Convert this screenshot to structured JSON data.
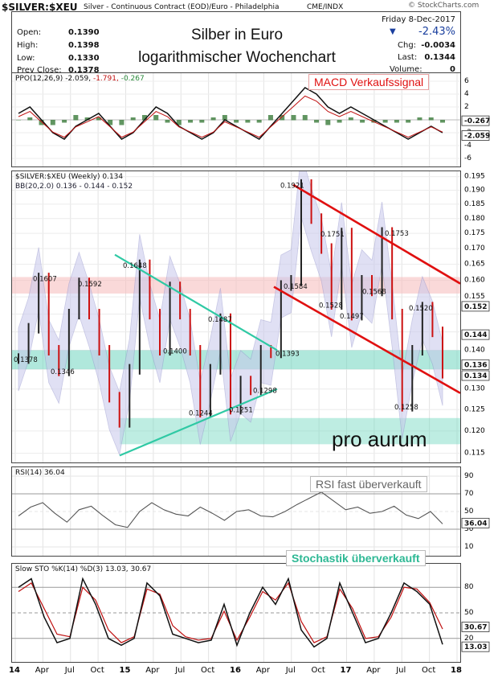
{
  "header": {
    "symbol": "$SILVER:$XEU",
    "description": "Silver - Continuous Contract (EOD)/Euro - Philadelphia",
    "exchange": "CME/INDX",
    "source": "© StockCharts.com",
    "date": "Friday  8-Dec-2017",
    "change_pct": "-2.43%",
    "chg": "-0.0034",
    "last": "0.1344",
    "volume": "0",
    "open": "0.1390",
    "high": "0.1398",
    "low": "0.1330",
    "prev_close": "0.1378",
    "labels": {
      "chg": "Chg:",
      "last": "Last:",
      "volume": "Volume:",
      "open": "Open:",
      "high": "High:",
      "low": "Low:",
      "prev_close": "Prev Close:"
    },
    "title_line1": "Silber in Euro",
    "title_line2": "logarithmischer Wochenchart"
  },
  "ppo": {
    "label": "PPO(12,26,9)",
    "v1": "-2.059,",
    "v2": "-1.791,",
    "v3": "-0.267",
    "ticks": [
      "6",
      "4",
      "2",
      "-2",
      "-4",
      "-6"
    ],
    "badge1": "-0.267",
    "badge2": "-2.059",
    "callout": "MACD Verkaufssignal"
  },
  "price": {
    "label": "$SILVER:$XEU (Weekly) 0.134",
    "bb_label": "BB(20,2.0) 0.136 - 0.144 - 0.152",
    "ticks": [
      "0.195",
      "0.190",
      "0.185",
      "0.180",
      "0.175",
      "0.170",
      "0.165",
      "0.160",
      "0.155",
      "0.150",
      "0.145",
      "0.140",
      "0.135",
      "0.130",
      "0.125",
      "0.120",
      "0.115"
    ],
    "badges": [
      "0.152",
      "0.144",
      "0.136",
      "0.134"
    ],
    "annotations": [
      "0.1378",
      "0.1607",
      "0.1346",
      "0.1592",
      "0.1648",
      "0.1400",
      "0.1244",
      "0.1487",
      "0.1251",
      "0.1298",
      "0.1393",
      "0.1584",
      "0.1921",
      "0.1528",
      "0.1751",
      "0.1497",
      "0.1568",
      "0.1753",
      "0.1520",
      "0.1258"
    ],
    "logo": "pro aurum"
  },
  "rsi": {
    "label": "RSI(14) 36.04",
    "ticks": [
      "90",
      "70",
      "50",
      "30",
      "10"
    ],
    "badge": "36.04",
    "callout": "RSI fast überverkauft"
  },
  "sto": {
    "label": "Slow STO %K(14) %D(3) 13.03, 30.67",
    "ticks": [
      "80",
      "50",
      "20"
    ],
    "badge1": "30.67",
    "badge2": "13.03",
    "callout": "Stochastik überverkauft"
  },
  "x_axis": [
    "14",
    "Apr",
    "Jul",
    "Oct",
    "15",
    "Apr",
    "Jul",
    "Oct",
    "16",
    "Apr",
    "Jul",
    "Oct",
    "17",
    "Apr",
    "Jul",
    "Oct",
    "18"
  ],
  "colors": {
    "up": "#222222",
    "down": "#cc1111",
    "bb_fill": "#c8c8ec",
    "teal": "#2fc9a4",
    "red_line": "#e01010",
    "pink_band": "#f6c0c0",
    "green_band": "#6fd6bf"
  },
  "chart_data": [
    {
      "type": "line",
      "title": "$SILVER:$XEU (Weekly) 0.134",
      "subtitle": "BB(20,2.0) 0.136 - 0.144 - 0.152",
      "scale": "log",
      "ylim": [
        0.113,
        0.197
      ],
      "x": [
        "14",
        "Apr",
        "Jul",
        "Oct",
        "15",
        "Apr",
        "Jul",
        "Oct",
        "16",
        "Apr",
        "Jul",
        "Oct",
        "17",
        "Apr",
        "Jul",
        "Oct",
        "18"
      ],
      "series": [
        {
          "name": "$SILVER:$XEU",
          "values": [
            0.1378,
            0.146,
            0.1607,
            0.14,
            0.1346,
            0.15,
            0.1592,
            0.15,
            0.14,
            0.128,
            0.122,
            0.135,
            0.1648,
            0.15,
            0.14,
            0.158,
            0.15,
            0.14,
            0.1244,
            0.135,
            0.1487,
            0.1251,
            0.132,
            0.1298,
            0.14,
            0.1393,
            0.1584,
            0.16,
            0.1921,
            0.18,
            0.17,
            0.1528,
            0.1751,
            0.1497,
            0.16,
            0.1568,
            0.1753,
            0.15,
            0.1258,
            0.14,
            0.152,
            0.145,
            0.134
          ]
        }
      ],
      "annotations": [
        {
          "label": "0.1921",
          "value": 0.1921
        },
        {
          "label": "0.1258",
          "value": 0.1258
        },
        {
          "label": "0.1244",
          "value": 0.1244
        }
      ]
    },
    {
      "type": "line",
      "title": "RSI(14) 36.04",
      "ylim": [
        0,
        100
      ],
      "series": [
        {
          "name": "RSI(14)",
          "values": [
            45,
            55,
            60,
            48,
            38,
            52,
            56,
            45,
            35,
            32,
            50,
            60,
            52,
            47,
            45,
            55,
            48,
            40,
            50,
            52,
            45,
            44,
            50,
            58,
            65,
            72,
            62,
            52,
            55,
            48,
            50,
            56,
            46,
            42,
            50,
            36
          ]
        }
      ]
    },
    {
      "type": "line",
      "title": "Slow STO %K(14) %D(3) 13.03, 30.67",
      "ylim": [
        0,
        100
      ],
      "series": [
        {
          "name": "%K",
          "values": [
            80,
            90,
            45,
            15,
            20,
            90,
            60,
            20,
            12,
            20,
            85,
            70,
            25,
            20,
            15,
            18,
            60,
            12,
            50,
            80,
            60,
            90,
            30,
            10,
            20,
            85,
            50,
            15,
            20,
            50,
            85,
            75,
            60,
            13
          ]
        },
        {
          "name": "%D",
          "values": [
            75,
            85,
            55,
            25,
            22,
            80,
            65,
            30,
            15,
            22,
            78,
            72,
            35,
            22,
            18,
            20,
            52,
            18,
            45,
            75,
            65,
            85,
            40,
            15,
            22,
            78,
            55,
            20,
            22,
            45,
            80,
            78,
            62,
            31
          ]
        }
      ]
    }
  ]
}
